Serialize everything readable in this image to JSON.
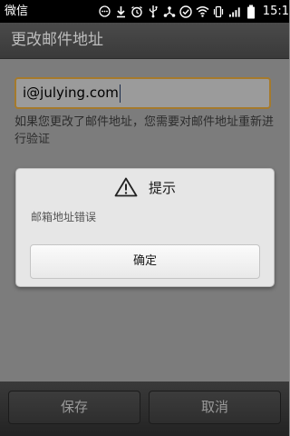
{
  "status_bar": {
    "carrier": "微信",
    "time": "15:1",
    "icons": [
      "chat-bubble-icon",
      "download-icon",
      "alarm-icon",
      "usb-icon",
      "share-icon",
      "check-circle-icon",
      "wifi-icon",
      "vibrate-icon",
      "signal-icon",
      "battery-icon"
    ]
  },
  "title_bar": {
    "title": "更改邮件地址"
  },
  "form": {
    "email_value": "i@julying.com",
    "hint": "如果您更改了邮件地址，您需要对邮件地址重新进行验证"
  },
  "buttons": {
    "save": "保存",
    "cancel": "取消"
  },
  "dialog": {
    "title": "提示",
    "message": "邮箱地址错误",
    "ok": "确定",
    "icon": "warning-icon"
  },
  "colors": {
    "status_bar": "#000000",
    "title_bar": "#444444",
    "input_focus_border": "#a57a2c",
    "dialog_bg": "#e6e6e6"
  }
}
